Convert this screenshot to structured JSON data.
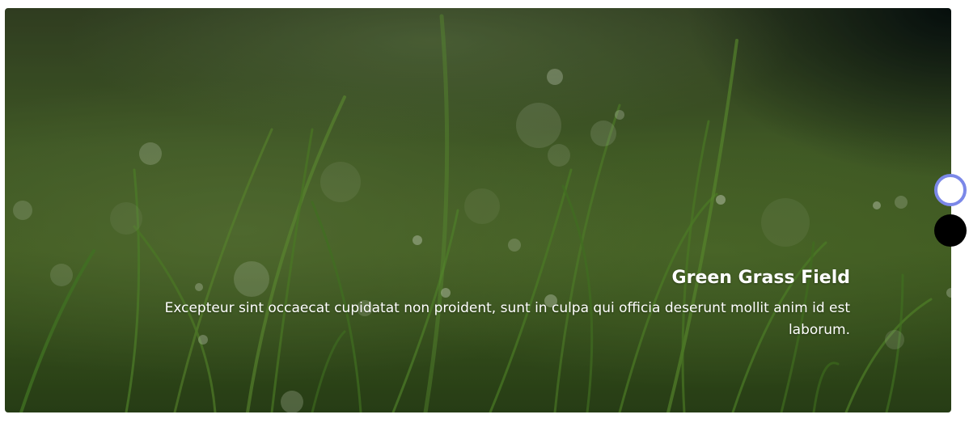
{
  "slider": {
    "active_index": 0,
    "slides": [
      {
        "title": "Green Grass Field",
        "text": "Excepteur sint occaecat cupidatat non proident, sunt in culpa qui officia deserunt mollit anim id est laborum."
      }
    ],
    "indicators": [
      {
        "state": "active"
      },
      {
        "state": "inactive"
      }
    ]
  },
  "colors": {
    "active_indicator_border": "#7b88e8",
    "active_indicator_fill": "#ffffff",
    "inactive_indicator_fill": "#000000",
    "caption_text": "#ffffff"
  }
}
